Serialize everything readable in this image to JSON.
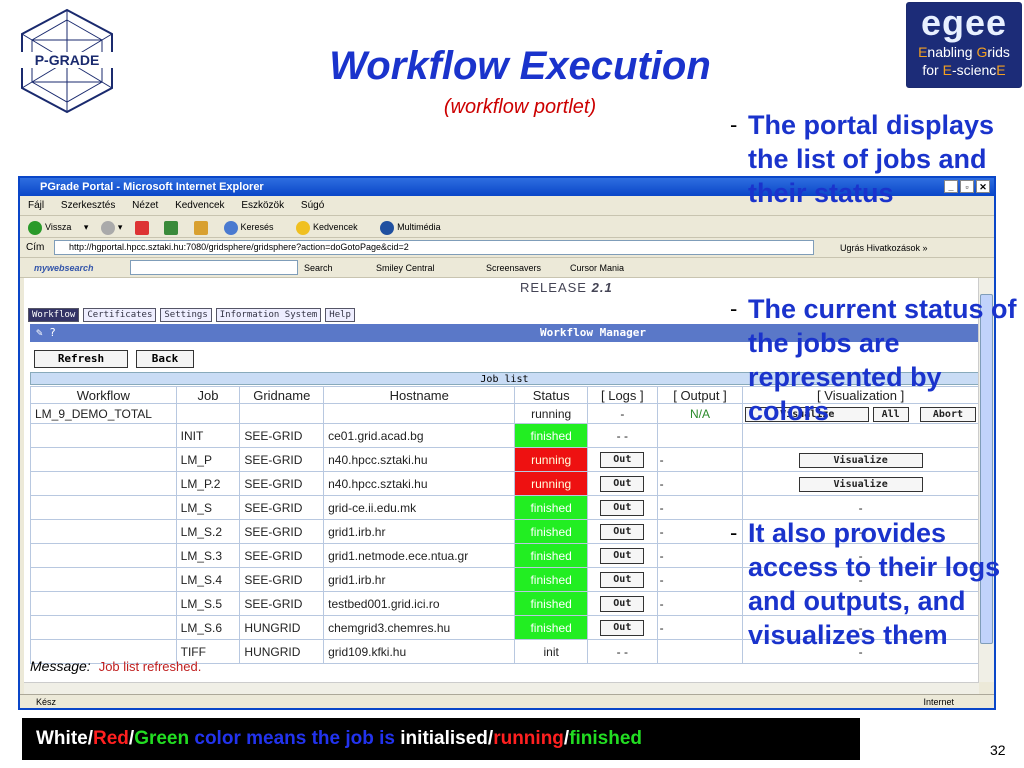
{
  "slide": {
    "title": "Workflow Execution",
    "subtitle": "(workflow portlet)",
    "logo_left_text": "P-GRADE",
    "logo_right": {
      "big": "egee",
      "line1_pre": "E",
      "line1": "nabling ",
      "line1_g": "G",
      "line1_end": "rids",
      "line2_pre": "for ",
      "line2_e": "E",
      "line2_end": "-scienc",
      "line2_e2": "E"
    },
    "bullets": [
      "The portal displays the list of jobs and their status",
      "The current status of the jobs are represented by colors",
      "It also provides access to their logs and outputs, and visualizes them"
    ],
    "dash": "-",
    "footer": {
      "white": "White",
      "slash1": "/",
      "red": "Red",
      "slash2": "/",
      "green": "Green",
      "middle": " color means the job is ",
      "initialised": "initialised",
      "slash3": "/",
      "running": "running",
      "slash4": "/",
      "finished": "finished"
    },
    "page_number": "32"
  },
  "browser": {
    "title": "PGrade Portal - Microsoft Internet Explorer",
    "menu": [
      "Fájl",
      "Szerkesztés",
      "Nézet",
      "Kedvencek",
      "Eszközök",
      "Súgó"
    ],
    "toolbar": [
      "Vissza",
      "Keresés",
      "Kedvencek",
      "Multimédia"
    ],
    "address_label": "Cím",
    "address": "http://hgportal.hpcc.sztaki.hu:7080/gridsphere/gridsphere?action=doGotoPage&cid=2",
    "links": "Ugrás   Hivatkozások »",
    "search_brand": "mywebsearch",
    "search_items": [
      "Search",
      "Smiley Central",
      "Screensavers",
      "Cursor Mania"
    ],
    "status": "Kész",
    "status_right": "Internet"
  },
  "portal": {
    "release_label": "RELEASE",
    "release_version": "2.1",
    "tabs": [
      "Workflow",
      "Certificates",
      "Settings",
      "Information System",
      "Help"
    ],
    "manager_title": "Workflow Manager",
    "manager_icons": "✎ ?",
    "refresh": "Refresh",
    "back": "Back",
    "job_list_title": "Job list",
    "headers": [
      "Workflow",
      "Job",
      "Gridname",
      "Hostname",
      "Status",
      "[ Logs ]",
      "[ Output ]",
      "[ Visualization ]"
    ],
    "workflow_row": {
      "workflow": "LM_9_DEMO_TOTAL",
      "status": "running",
      "logs": "-",
      "output": "N/A",
      "visualize": "Visualize",
      "all": "All",
      "abort": "Abort"
    },
    "jobs": [
      {
        "job": "INIT",
        "grid": "SEE-GRID",
        "host": "ce01.grid.acad.bg",
        "status": "finished",
        "logs": "- -",
        "out": "",
        "vis": ""
      },
      {
        "job": "LM_P",
        "grid": "SEE-GRID",
        "host": "n40.hpcc.sztaki.hu",
        "status": "running",
        "logs": "Out",
        "out": "-",
        "vis": "Visualize"
      },
      {
        "job": "LM_P.2",
        "grid": "SEE-GRID",
        "host": "n40.hpcc.sztaki.hu",
        "status": "running",
        "logs": "Out",
        "out": "-",
        "vis": "Visualize"
      },
      {
        "job": "LM_S",
        "grid": "SEE-GRID",
        "host": "grid-ce.ii.edu.mk",
        "status": "finished",
        "logs": "Out",
        "out": "-",
        "vis": "-"
      },
      {
        "job": "LM_S.2",
        "grid": "SEE-GRID",
        "host": "grid1.irb.hr",
        "status": "finished",
        "logs": "Out",
        "out": "-",
        "vis": "-"
      },
      {
        "job": "LM_S.3",
        "grid": "SEE-GRID",
        "host": "grid1.netmode.ece.ntua.gr",
        "status": "finished",
        "logs": "Out",
        "out": "-",
        "vis": "-"
      },
      {
        "job": "LM_S.4",
        "grid": "SEE-GRID",
        "host": "grid1.irb.hr",
        "status": "finished",
        "logs": "Out",
        "out": "-",
        "vis": "-"
      },
      {
        "job": "LM_S.5",
        "grid": "SEE-GRID",
        "host": "testbed001.grid.ici.ro",
        "status": "finished",
        "logs": "Out",
        "out": "-",
        "vis": "-"
      },
      {
        "job": "LM_S.6",
        "grid": "HUNGRID",
        "host": "chemgrid3.chemres.hu",
        "status": "finished",
        "logs": "Out",
        "out": "-",
        "vis": "-"
      },
      {
        "job": "TIFF",
        "grid": "HUNGRID",
        "host": "grid109.kfki.hu",
        "status": "init",
        "logs": "- -",
        "out": "",
        "vis": "-"
      }
    ],
    "message_label": "Message:",
    "message_text": "Job list refreshed."
  },
  "colors": {
    "title_blue": "#1a33cc",
    "finished": "#22ee22",
    "running": "#ee1111"
  }
}
